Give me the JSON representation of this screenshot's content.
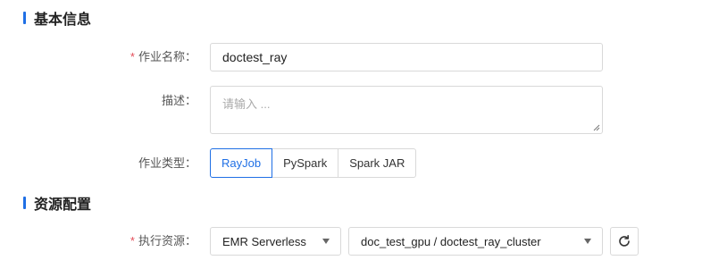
{
  "basic_section": {
    "title": "基本信息"
  },
  "job_name": {
    "required_mark": "*",
    "label": "作业名称：",
    "value": "doctest_ray"
  },
  "description": {
    "label": "描述：",
    "placeholder": "请输入 ..."
  },
  "job_type": {
    "label": "作业类型：",
    "options": [
      "RayJob",
      "PySpark",
      "Spark JAR"
    ],
    "selected": "RayJob"
  },
  "resource_section": {
    "title": "资源配置"
  },
  "exec_resource": {
    "required_mark": "*",
    "label": "执行资源：",
    "engine_value": "EMR Serverless",
    "cluster_value": "doc_test_gpu / doctest_ray_cluster"
  },
  "colors": {
    "accent": "#1f6fe5",
    "required": "#e34d59",
    "border": "#d9d9d9"
  }
}
